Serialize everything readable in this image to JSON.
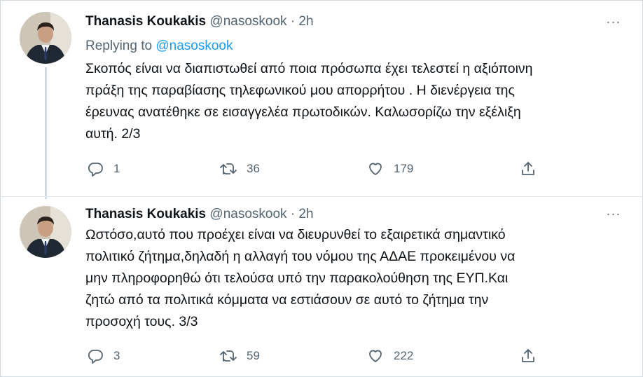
{
  "tweets": [
    {
      "name": "Thanasis Koukakis",
      "handle": "@nasoskook",
      "separator": "·",
      "time": "2h",
      "replying_prefix": "Replying to",
      "replying_handle": "@nasoskook",
      "text": "Σκοπός είναι να διαπιστωθεί από ποια πρόσωπα έχει τελεστεί η αξιόποινη\nπράξη της παραβίασης τηλεφωνικού μου απορρήτου . Η διενέργεια της\nέρευνας ανατέθηκε σε εισαγγελέα πρωτοδικών. Καλωσορίζω την εξέλιξη\nαυτή. 2/3",
      "replies": "1",
      "retweets": "36",
      "likes": "179",
      "more_label": "···"
    },
    {
      "name": "Thanasis Koukakis",
      "handle": "@nasoskook",
      "separator": "·",
      "time": "2h",
      "text": "Ωστόσο,αυτό που προέχει είναι να διευρυνθεί το εξαιρετικά σημαντικό\nπολιτικό ζήτημα,δηλαδή η αλλαγή του νόμου της ΑΔΑΕ προκειμένου να\nμην πληροφορηθώ ότι τελούσα υπό την παρακολούθηση της ΕΥΠ.Και\nζητώ από τα πολιτικά κόμματα να εστιάσουν σε αυτό το ζήτημα την\nπροσοχή τους. 3/3",
      "replies": "3",
      "retweets": "59",
      "likes": "222",
      "more_label": "···"
    }
  ],
  "icons": {
    "reply": "reply-icon",
    "retweet": "retweet-icon",
    "like": "heart-icon",
    "share": "share-icon",
    "more": "more-icon"
  },
  "colors": {
    "text": "#0f1419",
    "secondary": "#536471",
    "link": "#1d9bf0",
    "border": "#cfd9de"
  }
}
